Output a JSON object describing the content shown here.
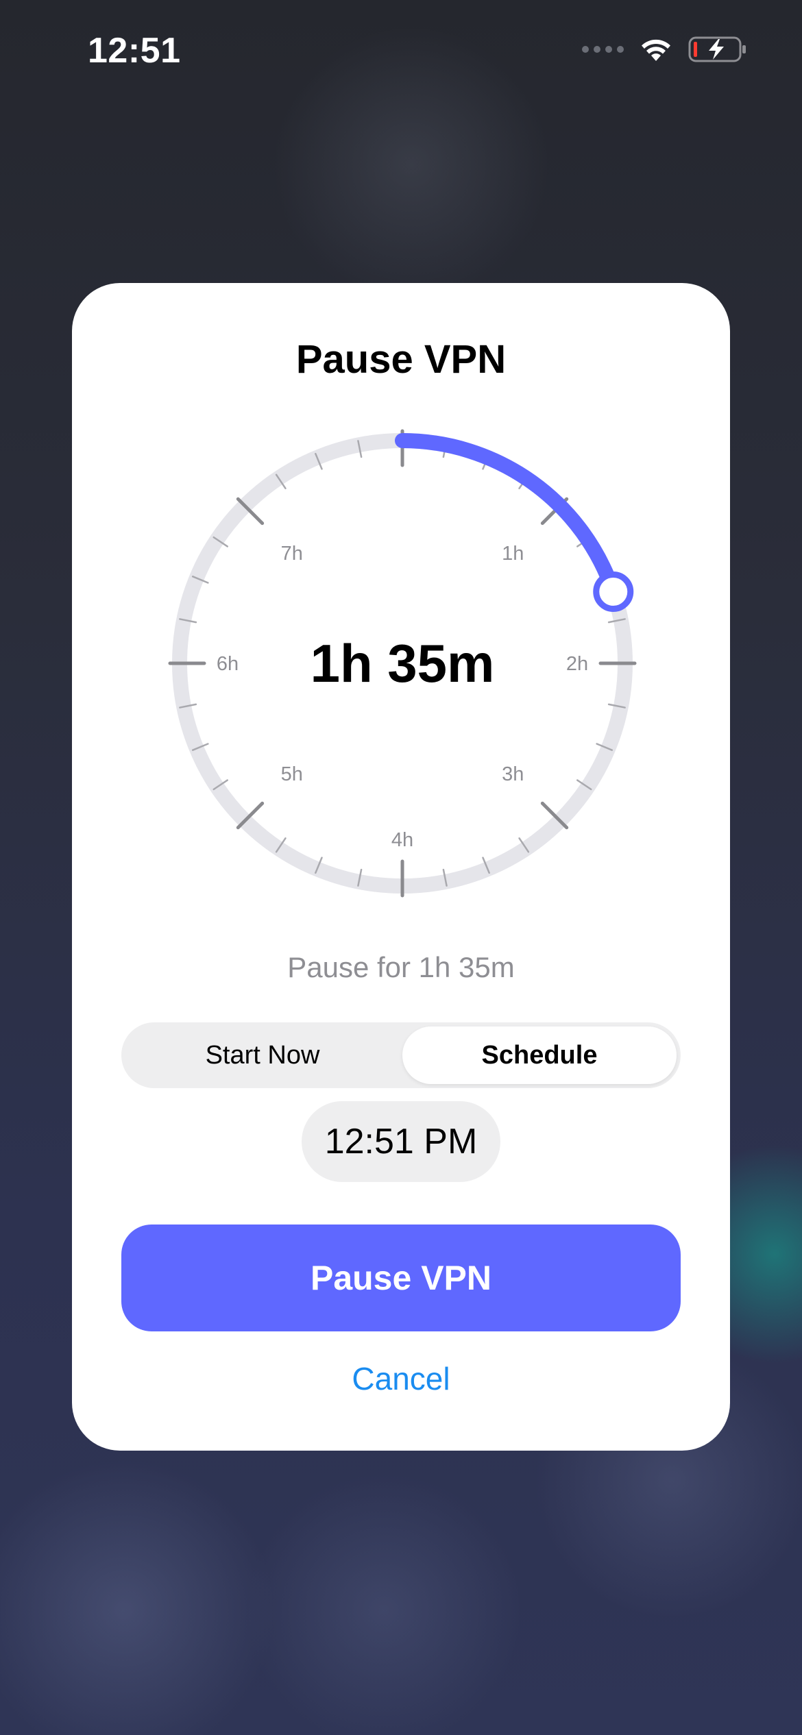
{
  "status_bar": {
    "time": "12:51",
    "icons": [
      "cellular-signal-icon",
      "wifi-icon",
      "battery-charging-icon"
    ]
  },
  "modal": {
    "title": "Pause VPN",
    "dial": {
      "value_text": "1h 35m",
      "hour_labels": [
        "1h",
        "2h",
        "3h",
        "4h",
        "5h",
        "6h",
        "7h"
      ],
      "max_hours": 8,
      "selected_minutes": 95,
      "accent_color": "#5f68ff",
      "track_color": "#e5e5ea"
    },
    "description": "Pause for 1h 35m",
    "segmented": {
      "options": [
        "Start Now",
        "Schedule"
      ],
      "selected": "Schedule"
    },
    "scheduled_time": "12:51 PM",
    "primary_button": "Pause VPN",
    "cancel_label": "Cancel"
  },
  "colors": {
    "accent": "#5f68ff",
    "link": "#1a8cf0",
    "secondary_text": "#8e8e93"
  }
}
